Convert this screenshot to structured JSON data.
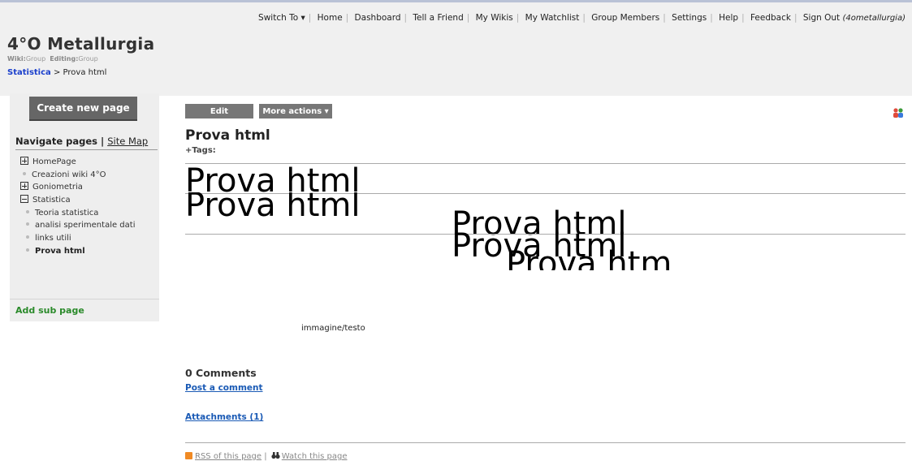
{
  "topnav": {
    "switch_to": "Switch To ▾",
    "home": "Home",
    "dashboard": "Dashboard",
    "tell_friend": "Tell a Friend",
    "my_wikis": "My Wikis",
    "my_watchlist": "My Watchlist",
    "group_members": "Group Members",
    "settings": "Settings",
    "help": "Help",
    "feedback": "Feedback",
    "sign_out": "Sign Out",
    "user": "(4ometallurgia)"
  },
  "site": {
    "title": "4°O Metallurgia",
    "wiki_label": "Wiki:",
    "wiki_value": "Group",
    "editing_label": "Editing:",
    "editing_value": "Group"
  },
  "breadcrumb": {
    "parent": "Statistica",
    "sep": " > ",
    "current": "Prova html"
  },
  "sidebar": {
    "create_button": "Create new page",
    "nav_title": "Navigate pages",
    "nav_sep": " | ",
    "site_map": "Site Map",
    "items": [
      {
        "label": "HomePage"
      },
      {
        "label": "Creazioni wiki 4°O"
      },
      {
        "label": "Goniometria"
      },
      {
        "label": "Statistica"
      },
      {
        "label": "Teoria statistica"
      },
      {
        "label": "analisi sperimentale dati"
      },
      {
        "label": "links utili"
      },
      {
        "label": "Prova html"
      }
    ],
    "add_sub_page": "Add sub page"
  },
  "toolbar": {
    "edit": "Edit",
    "more_actions": "More actions ▾"
  },
  "page": {
    "title": "Prova html",
    "tags": "+Tags:",
    "big_text": "Prova html",
    "big_text_partial": "Prova htm",
    "image_caption": "immagine/testo"
  },
  "comments": {
    "heading": "0 Comments",
    "post_link": "Post a comment",
    "attachments": "Attachments (1)"
  },
  "footer": {
    "rss": "RSS of this page",
    "sep": " | ",
    "watch": "Watch this page"
  },
  "colors": {
    "link_blue": "#1a5ab5",
    "breadcrumb_blue": "#1a3fcc",
    "add_sub_green": "#2a8a2a",
    "button_gray": "#777777"
  }
}
